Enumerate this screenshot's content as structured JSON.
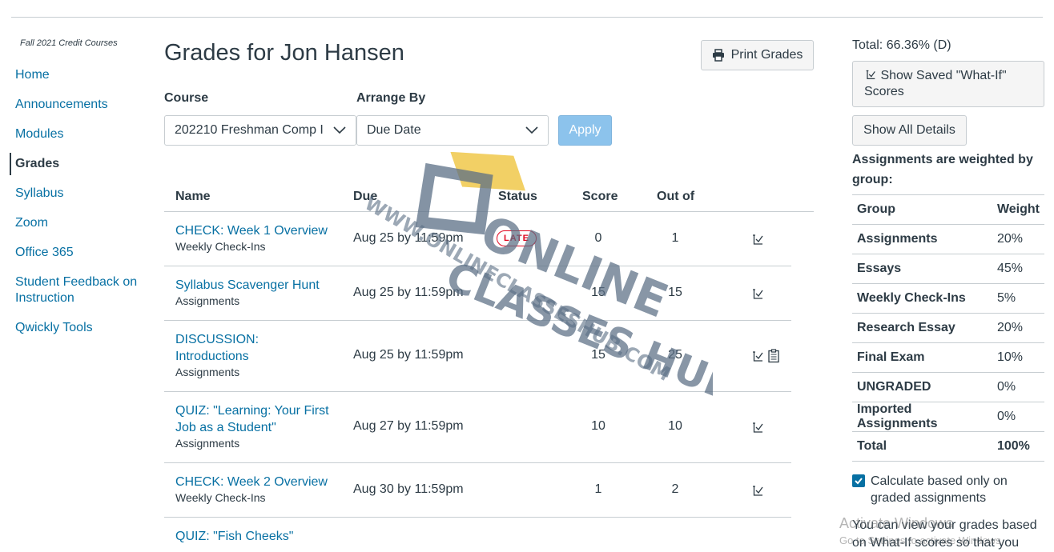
{
  "course_label": "Fall 2021 Credit Courses",
  "nav": [
    {
      "label": "Home"
    },
    {
      "label": "Announcements"
    },
    {
      "label": "Modules"
    },
    {
      "label": "Grades",
      "active": true
    },
    {
      "label": "Syllabus"
    },
    {
      "label": "Zoom"
    },
    {
      "label": "Office 365"
    },
    {
      "label": "Student Feedback on Instruction"
    },
    {
      "label": "Qwickly Tools"
    }
  ],
  "page_title": "Grades for Jon Hansen",
  "print_button": {
    "label": "Print Grades",
    "icon": "printer-icon"
  },
  "filters": {
    "course_label": "Course",
    "course_value": "202210 Freshman Comp I",
    "arrange_label": "Arrange By",
    "arrange_value": "Due Date",
    "apply_label": "Apply"
  },
  "table": {
    "headers": {
      "name": "Name",
      "due": "Due",
      "status": "Status",
      "score": "Score",
      "out_of": "Out of"
    },
    "rows": [
      {
        "title": "CHECK: Week 1 Overview",
        "group": "Weekly Check-Ins",
        "due": "Aug 25 by 11:59pm",
        "status": "LATE",
        "score": "0",
        "out_of": "1"
      },
      {
        "title": "Syllabus Scavenger Hunt",
        "group": "Assignments",
        "due": "Aug 25 by 11:59pm",
        "status": "",
        "score": "15",
        "out_of": "15"
      },
      {
        "title_lines": [
          "DISCUSSION:",
          "Introductions"
        ],
        "group": "Assignments",
        "due": "Aug 25 by 11:59pm",
        "status": "",
        "score": "15",
        "out_of": "25",
        "has_rubric": true
      },
      {
        "title_lines": [
          "QUIZ: \"Learning: Your First",
          "Job as a Student\""
        ],
        "group": "Assignments",
        "due": "Aug 27 by 11:59pm",
        "status": "",
        "score": "10",
        "out_of": "10"
      },
      {
        "title": "CHECK: Week 2 Overview",
        "group": "Weekly Check-Ins",
        "due": "Aug 30 by 11:59pm",
        "status": "",
        "score": "1",
        "out_of": "2"
      },
      {
        "title": "QUIZ: \"Fish Cheeks\""
      }
    ]
  },
  "sidebar": {
    "total": "Total: 66.36% (D)",
    "whatif_label": "Show Saved \"What-If\" Scores",
    "details_label": "Show All Details",
    "weighted_text": "Assignments are weighted by group:",
    "weights_header": {
      "group": "Group",
      "weight": "Weight"
    },
    "weights": [
      {
        "group": "Assignments",
        "weight": "20%"
      },
      {
        "group": "Essays",
        "weight": "45%"
      },
      {
        "group": "Weekly Check-Ins",
        "weight": "5%"
      },
      {
        "group": "Research Essay",
        "weight": "20%"
      },
      {
        "group": "Final Exam",
        "weight": "10%"
      },
      {
        "group": "UNGRADED",
        "weight": "0%"
      },
      {
        "group": "Imported Assignments",
        "weight": "0%"
      },
      {
        "group": "Total",
        "weight": "100%"
      }
    ],
    "calc_label": "Calculate based only on graded assignments",
    "calc_checked": true,
    "view_text": "You can view your grades based on What-If scores so that you"
  },
  "watermark": {
    "line1": "ONLINE",
    "line2": "CLASSES HUB",
    "url": "WWW.ONLINECLASSESHUB.COM"
  },
  "os_notice": {
    "line1": "Activate Windows",
    "line2": "Go to Settings to activate Windows."
  },
  "colors": {
    "link": "#0770a3",
    "late": "#e0061f",
    "apply": "#8cc3ec",
    "text": "#2d3b45"
  }
}
